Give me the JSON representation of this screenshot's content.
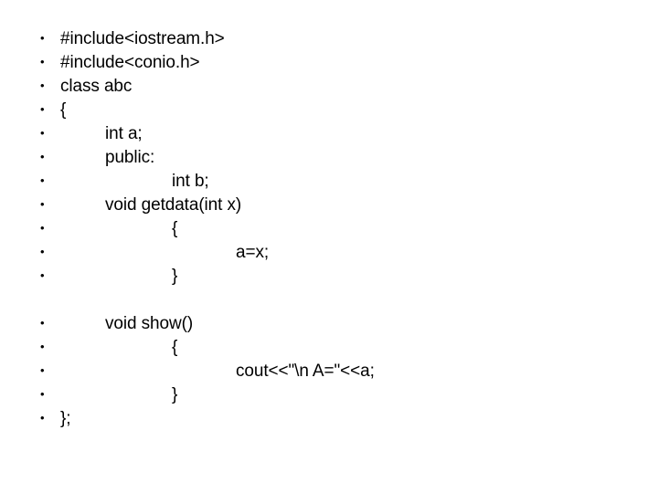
{
  "slide": {
    "background_color": "#ffffff",
    "text_color": "#000000",
    "bullet_glyph": "•"
  },
  "code": {
    "language": "cpp",
    "blocks": [
      {
        "lines": [
          {
            "text": "#include<iostream.h>",
            "indent": 0
          },
          {
            "text": "#include<conio.h>",
            "indent": 0
          },
          {
            "text": "class abc",
            "indent": 0
          },
          {
            "text": "{",
            "indent": 0
          },
          {
            "text": "int a;",
            "indent": 1
          },
          {
            "text": "public:",
            "indent": 1
          },
          {
            "text": "int b;",
            "indent": 2
          },
          {
            "text": "void getdata(int x)",
            "indent": 1
          },
          {
            "text": "{",
            "indent": 2
          },
          {
            "text": "a=x;",
            "indent": 3
          },
          {
            "text": "}",
            "indent": 2
          }
        ]
      },
      {
        "lines": [
          {
            "text": "void show()",
            "indent": 1
          },
          {
            "text": "{",
            "indent": 2
          },
          {
            "text": "cout<<\"\\n A=\"<<a;",
            "indent": 3
          },
          {
            "text": "}",
            "indent": 2
          },
          {
            "text": "};",
            "indent": 0
          }
        ]
      }
    ]
  }
}
